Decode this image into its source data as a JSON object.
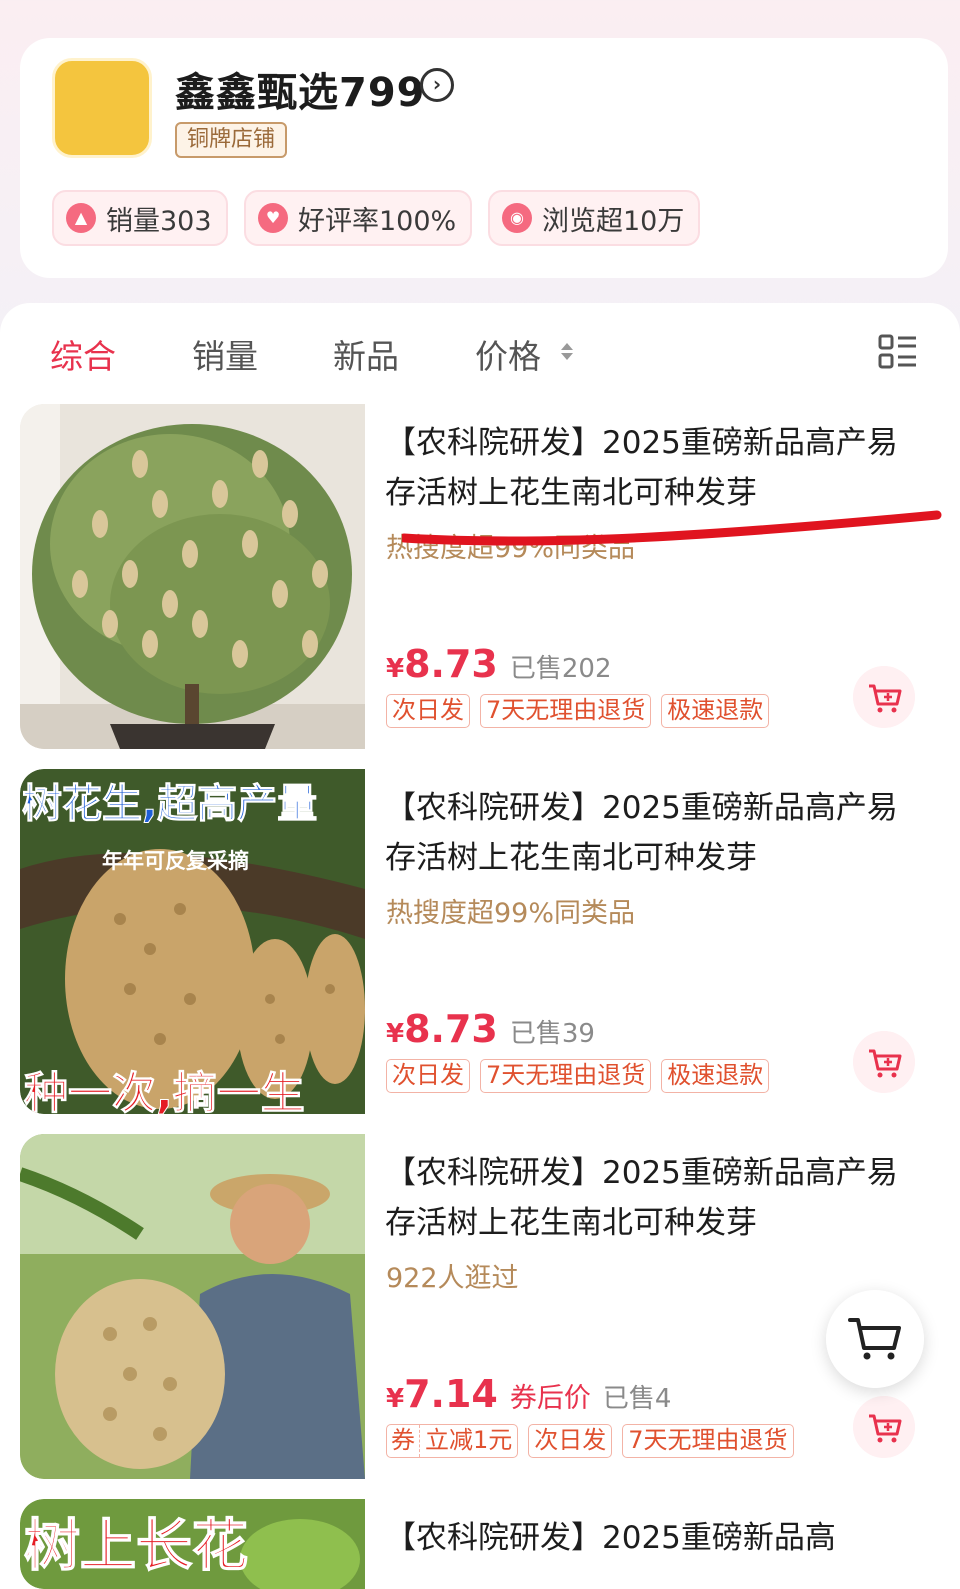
{
  "shop": {
    "name": "鑫鑫甄选799",
    "badge": "铜牌店铺",
    "stats": [
      {
        "label": "销量303",
        "icon": "arrow-up-icon"
      },
      {
        "label": "好评率100%",
        "icon": "heart-icon"
      },
      {
        "label": "浏览超10万",
        "icon": "eye-icon"
      }
    ]
  },
  "sort_tabs": [
    {
      "label": "综合",
      "active": true
    },
    {
      "label": "销量",
      "active": false
    },
    {
      "label": "新品",
      "active": false
    },
    {
      "label": "价格",
      "active": false
    }
  ],
  "products": [
    {
      "title": "【农科院研发】2025重磅新品高产易存活树上花生南北可种发芽",
      "hot": "热搜度超99%同类品",
      "price": "8.73",
      "yen": "¥",
      "sold": "已售202",
      "tags": [
        "次日发",
        "7天无理由退货",
        "极速退款"
      ]
    },
    {
      "title": "【农科院研发】2025重磅新品高产易存活树上花生南北可种发芽",
      "hot": "热搜度超99%同类品",
      "price": "8.73",
      "yen": "¥",
      "sold": "已售39",
      "tags": [
        "次日发",
        "7天无理由退货",
        "极速退款"
      ],
      "image_text": {
        "top": "树花生,超高产量",
        "mid": "年年可反复采摘",
        "bottom": "种一次,摘一生"
      }
    },
    {
      "title": "【农科院研发】2025重磅新品高产易存活树上花生南北可种发芽",
      "hot": "922人逛过",
      "price": "7.14",
      "yen": "¥",
      "coupon_after": "券后价",
      "sold": "已售4",
      "coupon_tag": {
        "a": "券",
        "b": "立减1元"
      },
      "tags": [
        "次日发",
        "7天无理由退货"
      ]
    },
    {
      "title": "【农科院研发】2025重磅新品高",
      "image_text": {
        "top": "树上长花"
      }
    }
  ],
  "colors": {
    "accent": "#e8324d",
    "tag": "#e0512f",
    "logo": "#f4c53e",
    "gold": "#b58a5a"
  }
}
